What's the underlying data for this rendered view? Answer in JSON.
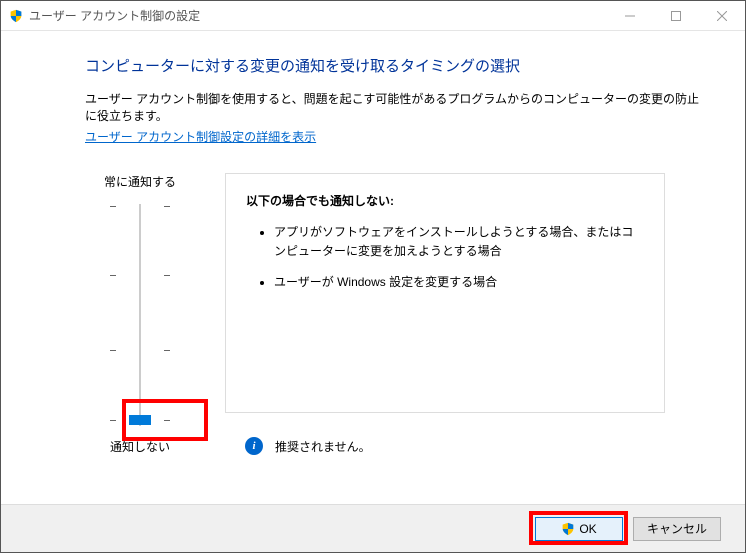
{
  "titlebar": {
    "title": "ユーザー アカウント制御の設定"
  },
  "heading": "コンピューターに対する変更の通知を受け取るタイミングの選択",
  "description": "ユーザー アカウント制御を使用すると、問題を起こす可能性があるプログラムからのコンピューターの変更の防止に役立ちます。",
  "link": "ユーザー アカウント制御設定の詳細を表示",
  "slider": {
    "topLabel": "常に通知する",
    "bottomLabel": "通知しない",
    "level": 0
  },
  "info": {
    "title": "以下の場合でも通知しない:",
    "items": [
      "アプリがソフトウェアをインストールしようとする場合、またはコンピューターに変更を加えようとする場合",
      "ユーザーが Windows 設定を変更する場合"
    ],
    "recommendation": "推奨されません。"
  },
  "footer": {
    "ok": "OK",
    "cancel": "キャンセル"
  }
}
